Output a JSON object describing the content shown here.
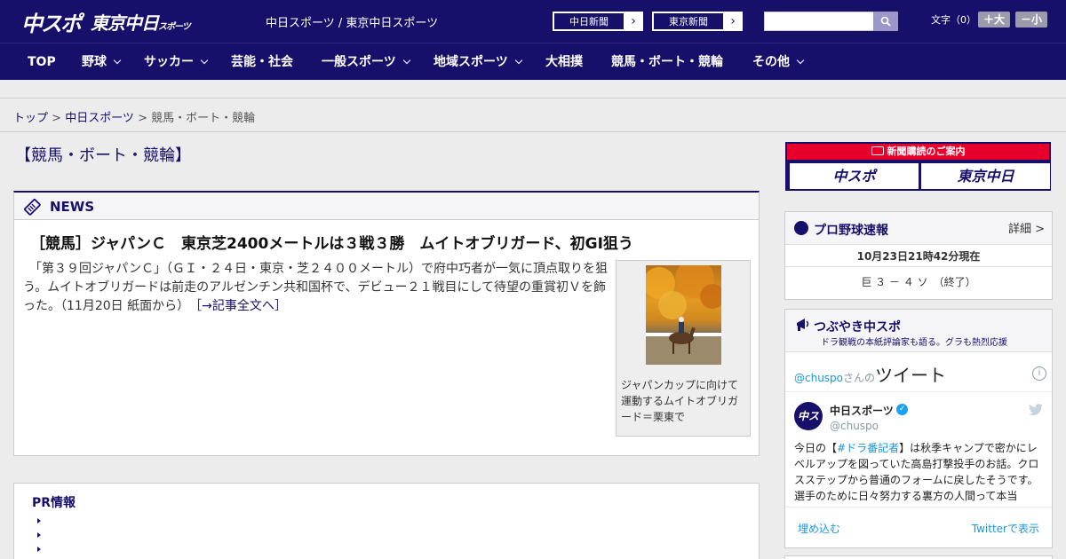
{
  "header": {
    "logo_main": "中スポ",
    "logo_sub": "東京中日",
    "logo_sub_small": "スポーツ",
    "site_names": "中日スポーツ / 東京中日スポーツ",
    "links": [
      {
        "label": "中日新聞"
      },
      {
        "label": "東京新聞"
      }
    ],
    "search": {
      "placeholder": "",
      "value": ""
    },
    "font_size_label": "文字（0）",
    "font_up": "＋大",
    "font_down": "－小"
  },
  "nav": {
    "items": [
      {
        "label": "TOP"
      },
      {
        "label": "野球"
      },
      {
        "label": "サッカー"
      },
      {
        "label": "芸能・社会"
      },
      {
        "label": "一般スポーツ"
      },
      {
        "label": "地域スポーツ"
      },
      {
        "label": "大相撲"
      },
      {
        "label": "競馬・ボート・競輪"
      },
      {
        "label": "その他"
      }
    ]
  },
  "breadcrumb": {
    "home": "トップ",
    "sep1": " > ",
    "section": "中日スポーツ",
    "sep2": " > ",
    "current": "競馬・ボート・競輪"
  },
  "page_title": "【競馬・ボート・競輪】",
  "news": {
    "heading": "NEWS",
    "title": "［競馬］ジャパンＣ　東京芝2400メートルは３戦３勝　ムイトオブリガード、初GI狙う",
    "body": "　「第３９回ジャパンＣ」（ＧＩ・２４日・東京・芝２４００メートル）で府中巧者が一気に頂点取りを狙う。ムイトオブリガードは前走のアルゼンチン共和国杯で、デビュー２１戦目にして待望の重賞初Ｖを飾った。（11月20日 紙面から）",
    "more": "［→記事全文へ］",
    "photo_caption": "ジャパンカップに向けて運動するムイトオブリガード＝栗東で"
  },
  "pr": {
    "title": "PR情報"
  },
  "subscribe": {
    "top": "新聞購読のご案内",
    "btn1": "中スポ",
    "btn2": "東京中日"
  },
  "baseball": {
    "title": "プロ野球速報",
    "detail": "詳細 >",
    "time": "10月23日21時42分現在",
    "score": "巨 ３ － ４ ソ　（終了）"
  },
  "twitter": {
    "title": "つぶやき中スポ",
    "subtitle": "ドラ観戦の本紙評論家も語る。グラも熱烈応援",
    "handle_link": "@chuspo",
    "san": "さんの",
    "tweets_label": "ツイート",
    "info": "i",
    "avatar_text": "中スポ",
    "name": "中日スポーツ",
    "handle": "@chuspo",
    "text_prefix": "今日の【",
    "text_tag": "#ドラ番記者",
    "text_rest": "】は秋季キャンプで密かにレベルアップを図っていた高島打撃投手のお話。クロスステップから普通のフォームに戻したそうです。選手のために日々努力する裏方の人間って本当",
    "embed": "埋め込む",
    "view": "Twitterで表示"
  }
}
